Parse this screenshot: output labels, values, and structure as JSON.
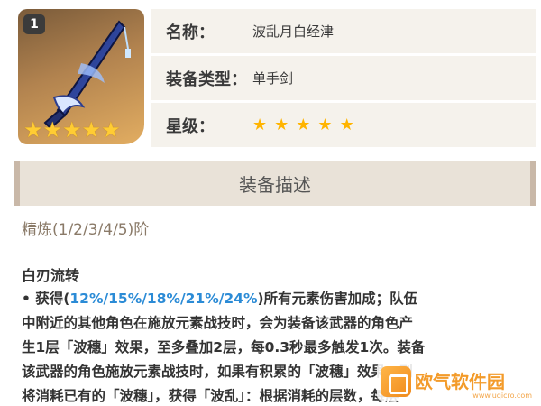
{
  "weapon": {
    "refine_rank": "1",
    "thumb_stars": [
      "★",
      "★",
      "★",
      "★",
      "★"
    ]
  },
  "info": {
    "name_label": "名称：",
    "name_value": "波乱月白经津",
    "type_label": "装备类型：",
    "type_value": "单手剑",
    "rarity_label": "星级：",
    "rarity_stars": [
      "★",
      "★",
      "★",
      "★",
      "★"
    ]
  },
  "section": {
    "title": "装备描述"
  },
  "refinement": {
    "text": "精炼(1/2/3/4/5)阶"
  },
  "skill": {
    "name": "白刃流转",
    "line1_prefix": "• 获得(",
    "line1_values": "12%/15%/18%/21%/24%",
    "line1_suffix": ")所有元素伤害加成；队伍",
    "line2": "中附近的其他角色在施放元素战技时，会为装备该武器的角色产",
    "line3": "生1层「波穗」效果，至多叠加2层，每0.3秒最多触发1次。装备",
    "line4": "该武器的角色施放元素战技时，如果有积累的「波穗」效果，则",
    "line5": "将消耗已有的「波穗」，获得「波乱」：根据消耗的层数，每层"
  },
  "watermark": {
    "text": "欧气软件园",
    "url": "www.uqicro.com"
  },
  "colors": {
    "highlight": "#2b8bd6",
    "star": "#ffb400",
    "row_bg": "#f5f2ec",
    "section_bg": "#e9e2d8"
  }
}
